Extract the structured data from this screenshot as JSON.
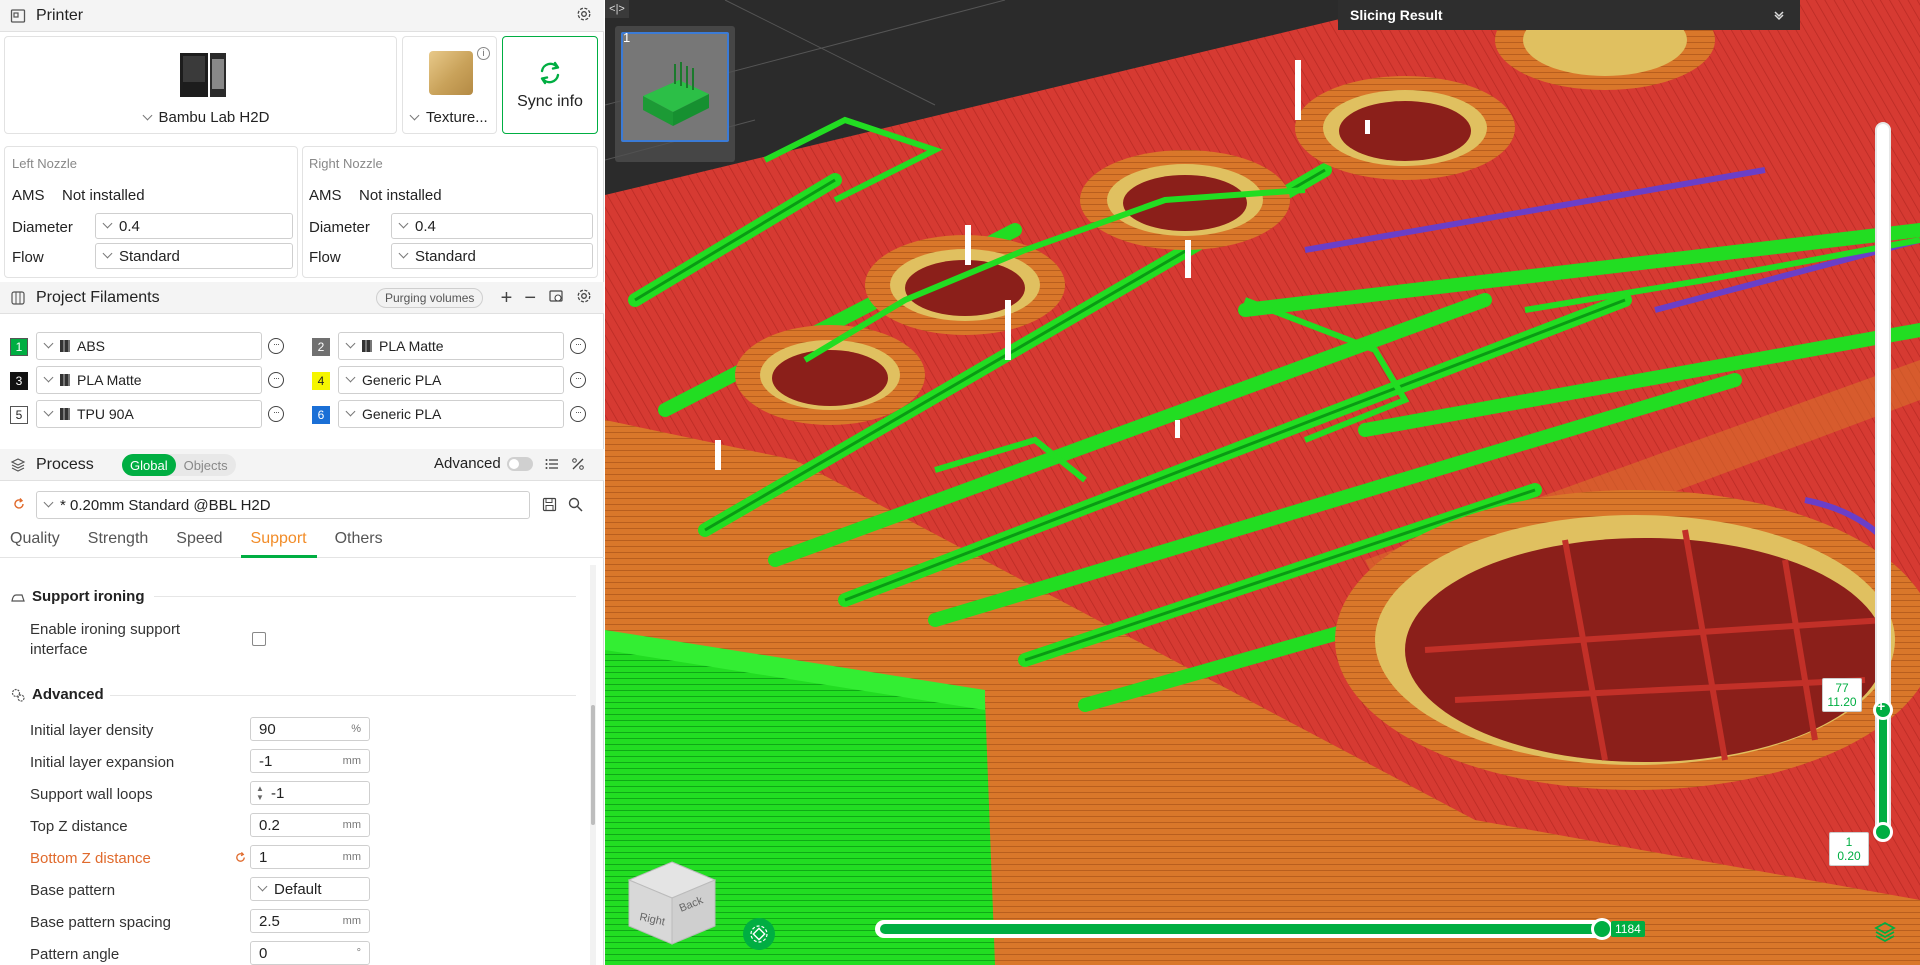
{
  "printer": {
    "section_title": "Printer",
    "printer_name": "Bambu Lab H2D",
    "plate_name": "Texture...",
    "sync_label": "Sync info",
    "left_nozzle": {
      "title": "Left Nozzle",
      "ams_label": "AMS",
      "ams_value": "Not installed",
      "diameter_label": "Diameter",
      "diameter_value": "0.4",
      "flow_label": "Flow",
      "flow_value": "Standard"
    },
    "right_nozzle": {
      "title": "Right Nozzle",
      "ams_label": "AMS",
      "ams_value": "Not installed",
      "diameter_label": "Diameter",
      "diameter_value": "0.4",
      "flow_label": "Flow",
      "flow_value": "Standard"
    }
  },
  "filaments": {
    "section_title": "Project Filaments",
    "purging_label": "Purging volumes",
    "items": [
      {
        "num": "1",
        "name": "ABS",
        "color": "#00ae42",
        "text_color": "#ffffff"
      },
      {
        "num": "2",
        "name": "PLA Matte",
        "color": "#707070",
        "text_color": "#ffffff"
      },
      {
        "num": "3",
        "name": "PLA Matte",
        "color": "#111111",
        "text_color": "#ffffff"
      },
      {
        "num": "4",
        "name": "Generic PLA",
        "color": "#f5f500",
        "text_color": "#222222"
      },
      {
        "num": "5",
        "name": "TPU 90A",
        "color": "#ffffff",
        "text_color": "#222222"
      },
      {
        "num": "6",
        "name": "Generic PLA",
        "color": "#1a6fd6",
        "text_color": "#ffffff"
      }
    ]
  },
  "process": {
    "section_title": "Process",
    "global_label": "Global",
    "objects_label": "Objects",
    "advanced_label": "Advanced",
    "profile": "* 0.20mm Standard @BBL H2D",
    "tabs": [
      "Quality",
      "Strength",
      "Speed",
      "Support",
      "Others"
    ],
    "active_tab": "Support",
    "groups": {
      "ironing_title": "Support ironing",
      "ironing_label": "Enable ironing support interface",
      "advanced_title": "Advanced"
    },
    "params": [
      {
        "label": "Initial layer density",
        "value": "90",
        "unit": "%"
      },
      {
        "label": "Initial layer expansion",
        "value": "-1",
        "unit": "mm"
      },
      {
        "label": "Support wall loops",
        "value": "-1",
        "unit": ""
      },
      {
        "label": "Top Z distance",
        "value": "0.2",
        "unit": "mm"
      },
      {
        "label": "Bottom Z distance",
        "value": "1",
        "unit": "mm"
      },
      {
        "label": "Base pattern",
        "value": "Default",
        "unit": ""
      },
      {
        "label": "Base pattern spacing",
        "value": "2.5",
        "unit": "mm"
      },
      {
        "label": "Pattern angle",
        "value": "0",
        "unit": "°"
      }
    ]
  },
  "viewport": {
    "plate_number": "1",
    "slicing_result": "Slicing Result",
    "layer_top": {
      "layer": "77",
      "height": "11.20"
    },
    "layer_bottom": {
      "layer": "1",
      "height": "0.20"
    },
    "move_count": "1184",
    "cube_right": "Right",
    "cube_back": "Back",
    "colors": {
      "accent": "#00ae42",
      "support": "#22dd22",
      "wall_red": "#d63a32",
      "wall_orange": "#d9772a",
      "bg": "#2b2b2b"
    }
  }
}
